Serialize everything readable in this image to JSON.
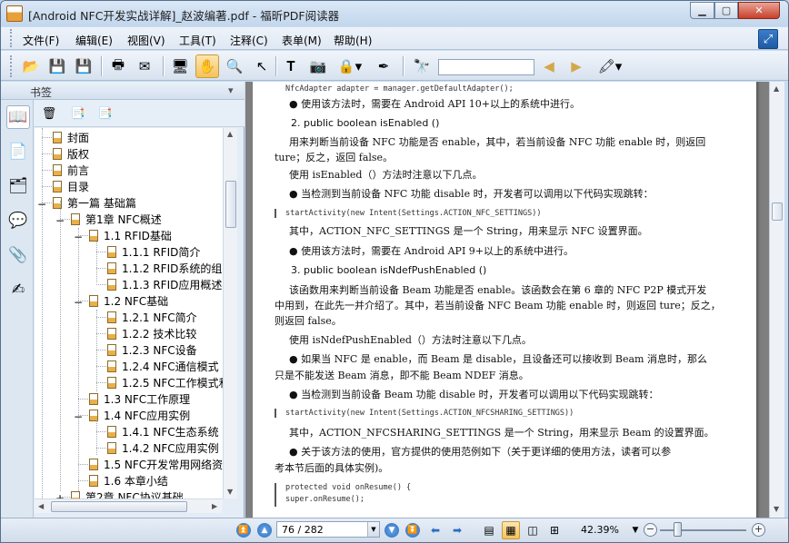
{
  "window": {
    "title": "[Android NFC开发实战详解]_赵波编著.pdf - 福昕PDF阅读器"
  },
  "menu": [
    "文件(F)",
    "编辑(E)",
    "视图(V)",
    "工具(T)",
    "注释(C)",
    "表单(M)",
    "帮助(H)"
  ],
  "toolbar": {
    "icons": [
      "open-folder-icon",
      "save-icon",
      "save-as-icon",
      "print-icon",
      "email-icon",
      "fullscreen-icon",
      "hand-tool-icon",
      "zoom-in-tool-icon",
      "select-arrow-icon",
      "text-select-icon",
      "snapshot-icon",
      "rms-icon",
      "sign-icon",
      "find-binoculars-icon",
      "prev-find-icon",
      "next-find-icon",
      "highlight-icon"
    ],
    "find_value": ""
  },
  "bookmarks": {
    "title": "书签",
    "items": [
      {
        "label": "封面",
        "level": 1
      },
      {
        "label": "版权",
        "level": 1
      },
      {
        "label": "前言",
        "level": 1
      },
      {
        "label": "目录",
        "level": 1
      },
      {
        "label": "第一篇 基础篇",
        "level": 1,
        "toggle": "−"
      },
      {
        "label": "第1章 NFC概述",
        "level": 2,
        "toggle": "−"
      },
      {
        "label": "1.1 RFID基础",
        "level": 3,
        "toggle": "−"
      },
      {
        "label": "1.1.1 RFID简介",
        "level": 4
      },
      {
        "label": "1.1.2 RFID系统的组",
        "level": 4
      },
      {
        "label": "1.1.3 RFID应用概述",
        "level": 4
      },
      {
        "label": "1.2 NFC基础",
        "level": 3,
        "toggle": "−"
      },
      {
        "label": "1.2.1 NFC简介",
        "level": 4
      },
      {
        "label": "1.2.2 技术比较",
        "level": 4
      },
      {
        "label": "1.2.3 NFC设备",
        "level": 4
      },
      {
        "label": "1.2.4 NFC通信模式",
        "level": 4
      },
      {
        "label": "1.2.5 NFC工作模式和",
        "level": 4
      },
      {
        "label": "1.3 NFC工作原理",
        "level": 3
      },
      {
        "label": "1.4 NFC应用实例",
        "level": 3,
        "toggle": "−"
      },
      {
        "label": "1.4.1 NFC生态系统",
        "level": 4
      },
      {
        "label": "1.4.2 NFC应用实例",
        "level": 4
      },
      {
        "label": "1.5 NFC开发常用网络资",
        "level": 3
      },
      {
        "label": "1.6 本章小结",
        "level": 3
      },
      {
        "label": "第2章 NFC协议基础",
        "level": 2,
        "toggle": "+"
      }
    ]
  },
  "document": {
    "lines": [
      {
        "t": "NfcAdapter adapter = manager.getDefaultAdapter();",
        "k": "code"
      },
      {
        "t": "● 使用该方法时，需要在 Android API 10+以上的系统中进行。",
        "k": "p"
      },
      {
        "t": "2.  public boolean isEnabled ()",
        "k": "head"
      },
      {
        "t": "用来判断当前设备 NFC 功能是否 enable，其中，若当前设备 NFC 功能 enable 时，则返回",
        "k": "p"
      },
      {
        "t": "ture；反之，返回 false。",
        "k": "p"
      },
      {
        "t": "使用 isEnabled（）方法时注意以下几点。",
        "k": "p"
      },
      {
        "t": "● 当检测到当前设备 NFC 功能 disable 时，开发者可以调用以下代码实现跳转：",
        "k": "p"
      },
      {
        "t": "startActivity(new Intent(Settings.ACTION_NFC_SETTINGS))",
        "k": "code"
      },
      {
        "t": "其中，ACTION_NFC_SETTINGS 是一个 String，用来显示 NFC 设置界面。",
        "k": "p"
      },
      {
        "t": "● 使用该方法时，需要在 Android API 9+以上的系统中进行。",
        "k": "p"
      },
      {
        "t": "3.  public boolean isNdefPushEnabled ()",
        "k": "head"
      },
      {
        "t": "该函数用来判断当前设备 Beam 功能是否 enable。该函数会在第 6 章的 NFC P2P 模式开发",
        "k": "p"
      },
      {
        "t": "中用到，在此先一并介绍了。其中，若当前设备 NFC Beam 功能 enable 时，则返回 ture；反之，",
        "k": "p"
      },
      {
        "t": "则返回 false。",
        "k": "p"
      },
      {
        "t": "使用 isNdefPushEnabled（）方法时注意以下几点。",
        "k": "p"
      },
      {
        "t": "● 如果当 NFC 是 enable，而 Beam 是 disable，且设备还可以接收到 Beam 消息时，那么",
        "k": "p"
      },
      {
        "t": "只是不能发送 Beam 消息，即不能 Beam NDEF 消息。",
        "k": "p"
      },
      {
        "t": "● 当检测到当前设备 Beam 功能 disable 时，开发者可以调用以下代码实现跳转：",
        "k": "p"
      },
      {
        "t": "startActivity(new Intent(Settings.ACTION_NFCSHARING_SETTINGS))",
        "k": "code"
      },
      {
        "t": "其中，ACTION_NFCSHARING_SETTINGS 是一个 String，用来显示 Beam 的设置界面。",
        "k": "p"
      },
      {
        "t": "● 关于该方法的使用，官方提供的使用范例如下（关于更详细的使用方法，读者可以参",
        "k": "p"
      },
      {
        "t": "考本节后面的具体实例)。",
        "k": "p"
      },
      {
        "t": "protected void onResume() {",
        "k": "code"
      },
      {
        "t": "    super.onResume();",
        "k": "code"
      }
    ]
  },
  "statusbar": {
    "page": "76 / 282",
    "zoom": "42.39%"
  }
}
